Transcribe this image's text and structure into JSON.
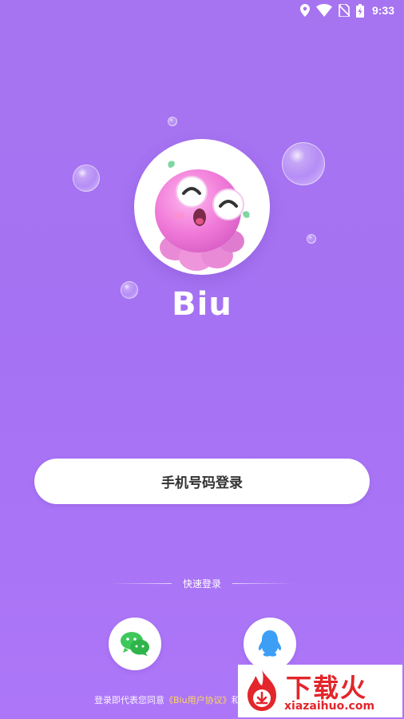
{
  "status_bar": {
    "time": "9:33",
    "icons": [
      "location-icon",
      "wifi-icon",
      "no-sim-icon",
      "battery-charging-icon"
    ]
  },
  "app": {
    "name": "Biu",
    "logo": "octopus-mascot-logo"
  },
  "login": {
    "phone_button": "手机号码登录",
    "quick_label": "快速登录",
    "wechat_icon": "wechat-icon",
    "qq_icon": "qq-icon"
  },
  "agreement": {
    "prefix": "登录即代表您同意",
    "link": "《Biu用户协议》",
    "suffix": "和"
  },
  "watermark": {
    "title": "下载火",
    "subtitle": "xiazaihuo.com"
  },
  "colors": {
    "background": "#a674f0",
    "wechat": "#3cc85a",
    "qq": "#3d9ef5",
    "link": "#ffd955",
    "watermark": "#e2262b"
  }
}
